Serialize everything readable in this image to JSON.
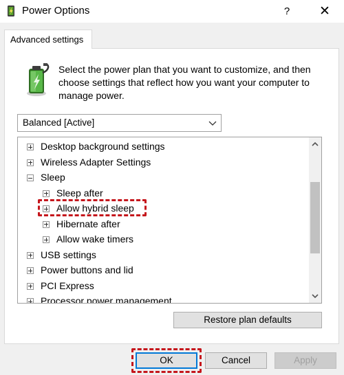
{
  "window": {
    "title": "Power Options",
    "help_label": "?",
    "close_label": "✕"
  },
  "tab": {
    "label": "Advanced settings"
  },
  "description": "Select the power plan that you want to customize, and then choose settings that reflect how you want your computer to manage power.",
  "plan_dropdown": {
    "selected": "Balanced [Active]"
  },
  "tree": {
    "items": [
      {
        "label": "Desktop background settings",
        "state": "collapsed",
        "level": 0
      },
      {
        "label": "Wireless Adapter Settings",
        "state": "collapsed",
        "level": 0
      },
      {
        "label": "Sleep",
        "state": "expanded",
        "level": 0
      },
      {
        "label": "Sleep after",
        "state": "collapsed",
        "level": 1
      },
      {
        "label": "Allow hybrid sleep",
        "state": "collapsed",
        "level": 1
      },
      {
        "label": "Hibernate after",
        "state": "collapsed",
        "level": 1
      },
      {
        "label": "Allow wake timers",
        "state": "collapsed",
        "level": 1
      },
      {
        "label": "USB settings",
        "state": "collapsed",
        "level": 0
      },
      {
        "label": "Power buttons and lid",
        "state": "collapsed",
        "level": 0
      },
      {
        "label": "PCI Express",
        "state": "collapsed",
        "level": 0
      },
      {
        "label": "Processor power management",
        "state": "collapsed",
        "level": 0
      }
    ]
  },
  "buttons": {
    "restore": "Restore plan defaults",
    "ok": "OK",
    "cancel": "Cancel",
    "apply": "Apply"
  },
  "colors": {
    "highlight": "#c5161c",
    "battery_green": "#3a9c2f",
    "default_button_border": "#0078d7"
  },
  "icons": {
    "title": "power-options-icon",
    "plan": "battery-icon",
    "dropdown": "chevron-down-icon",
    "scroll_up": "chevron-up-icon",
    "scroll_down": "chevron-down-icon",
    "expand": "plus-box-icon",
    "collapse": "minus-box-icon"
  }
}
